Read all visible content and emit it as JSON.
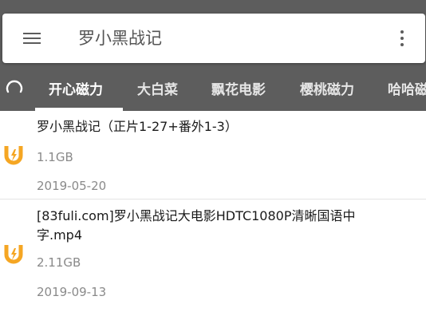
{
  "search": {
    "query": "罗小黑战记"
  },
  "tabs": [
    {
      "label": "开心磁力",
      "active": true
    },
    {
      "label": "大白菜",
      "active": false
    },
    {
      "label": "飘花电影",
      "active": false
    },
    {
      "label": "樱桃磁力",
      "active": false
    },
    {
      "label": "哈哈磁",
      "active": false
    }
  ],
  "results": [
    {
      "title": "罗小黑战记（正片1-27+番外1-3）",
      "size": "1.1GB",
      "date": "2019-05-20",
      "icon": "magnet-icon"
    },
    {
      "title": "[83fuli.com]罗小黑战记大电影HDTC1080P清晰国语中字.mp4",
      "size": "2.11GB",
      "date": "2019-09-13",
      "icon": "magnet-icon"
    }
  ],
  "colors": {
    "appbar": "#5d5d5d",
    "tab_active": "#ffffff",
    "magnet_orange": "#f5a623"
  }
}
